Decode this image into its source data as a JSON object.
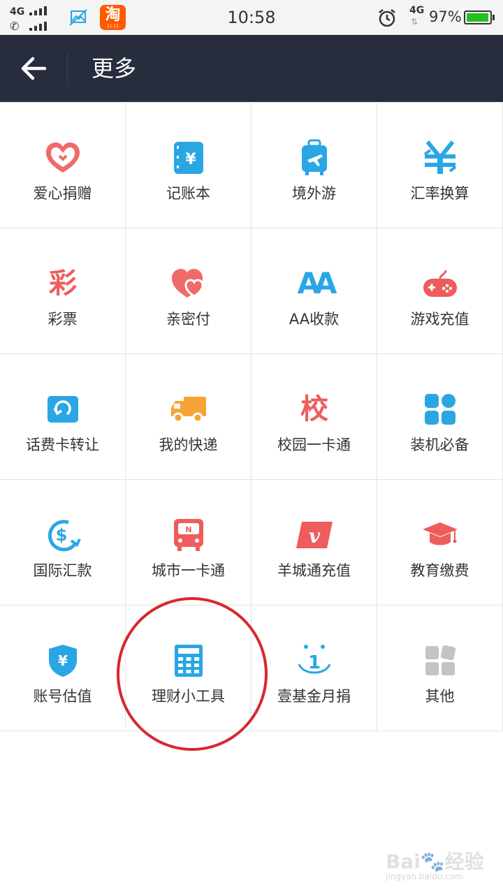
{
  "status_bar": {
    "network_top": "4G",
    "time": "10:58",
    "network_right": "4G",
    "network_arrows": "⇅",
    "battery_percent": "97%",
    "battery_level": 0.97,
    "taobao_label": "淘",
    "taobao_sub": "11.11",
    "icons": [
      "signal-icon",
      "phone-signal-icon",
      "image-icon",
      "taobao-icon",
      "alarm-icon",
      "battery-icon"
    ]
  },
  "title_bar": {
    "title": "更多",
    "back_icon": "back-arrow-icon"
  },
  "grid": {
    "items": [
      {
        "label": "爱心捐赠",
        "icon": "heart-outline-icon",
        "color": "#f06a6a"
      },
      {
        "label": "记账本",
        "icon": "account-book-icon",
        "color": "#2aa6e4"
      },
      {
        "label": "境外游",
        "icon": "luggage-plane-icon",
        "color": "#2aa6e4"
      },
      {
        "label": "汇率换算",
        "icon": "yen-exchange-icon",
        "color": "#2aa6e4"
      },
      {
        "label": "彩票",
        "icon": "lottery-icon",
        "icon_text": "彩",
        "color": "#ee5c5c"
      },
      {
        "label": "亲密付",
        "icon": "double-heart-icon",
        "color": "#f06a6a"
      },
      {
        "label": "AA收款",
        "icon": "aa-icon",
        "icon_text": "AA",
        "color": "#2aa6e4"
      },
      {
        "label": "游戏充值",
        "icon": "gamepad-icon",
        "color": "#ee5c5c"
      },
      {
        "label": "话费卡转让",
        "icon": "refresh-card-icon",
        "color": "#2aa6e4"
      },
      {
        "label": "我的快递",
        "icon": "delivery-truck-icon",
        "color": "#f7a336"
      },
      {
        "label": "校园一卡通",
        "icon": "school-icon",
        "icon_text": "校",
        "color": "#ee5c5c"
      },
      {
        "label": "装机必备",
        "icon": "apps-grid-icon",
        "color": "#2aa6e4"
      },
      {
        "label": "国际汇款",
        "icon": "dollar-transfer-icon",
        "color": "#2aa6e4"
      },
      {
        "label": "城市一卡通",
        "icon": "bus-icon",
        "color": "#ee5c5c"
      },
      {
        "label": "羊城通充值",
        "icon": "v-card-icon",
        "icon_text": "V",
        "color": "#ee5c5c"
      },
      {
        "label": "教育缴费",
        "icon": "graduation-cap-icon",
        "color": "#ee5c5c"
      },
      {
        "label": "账号估值",
        "icon": "yen-shield-icon",
        "color": "#2aa6e4"
      },
      {
        "label": "理财小工具",
        "icon": "calculator-icon",
        "color": "#2aa6e4"
      },
      {
        "label": "壹基金月捐",
        "icon": "smile-one-icon",
        "icon_text": "1",
        "color": "#2aa6e4"
      },
      {
        "label": "其他",
        "icon": "more-grid-icon",
        "color": "#c4c4c4"
      }
    ]
  },
  "watermark": {
    "logo": "Bai🐾经验",
    "url": "jingyan.baidu.com"
  }
}
